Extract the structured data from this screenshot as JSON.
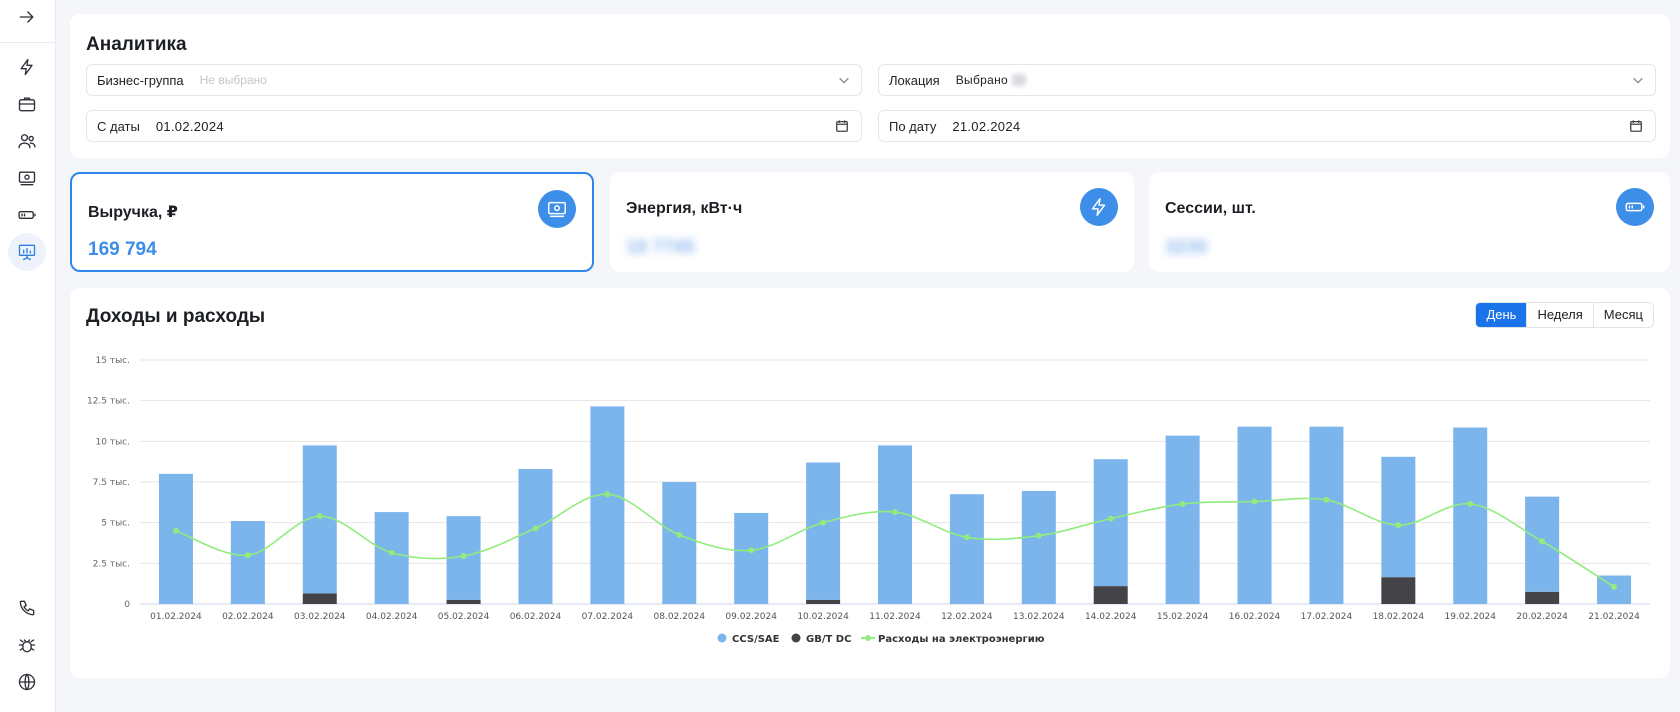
{
  "sidebar": {
    "icons": [
      "arrow-right-icon",
      "lightning-icon",
      "briefcase-icon",
      "users-icon",
      "money-icon",
      "battery-icon",
      "analytics-icon",
      "phone-icon",
      "bug-icon",
      "globe-icon"
    ],
    "active": "analytics-icon"
  },
  "filters": {
    "title": "Аналитика",
    "business_group": {
      "label": "Бизнес-группа",
      "placeholder": "Не выбрано"
    },
    "location": {
      "label": "Локация",
      "value": "Выбрано"
    },
    "date_from": {
      "label": "С даты",
      "value": "01.02.2024"
    },
    "date_to": {
      "label": "По дату",
      "value": "21.02.2024"
    }
  },
  "stats": {
    "revenue": {
      "title": "Выручка, ₽",
      "value": "169 794",
      "icon": "money-icon"
    },
    "energy": {
      "title": "Энергия, кВт·ч",
      "value": "18 7745",
      "icon": "lightning-icon"
    },
    "sessions": {
      "title": "Сессии, шт.",
      "value": "3230",
      "icon": "battery-icon"
    }
  },
  "chart_section": {
    "title": "Доходы и расходы",
    "periods": [
      "День",
      "Неделя",
      "Месяц"
    ],
    "active_period": "День"
  },
  "colors": {
    "accent": "#1a73e8",
    "bar_ccs": "#7cb4ec",
    "bar_gbt": "#434348",
    "line": "#90ed7d"
  },
  "chart_data": {
    "type": "bar",
    "stacked": true,
    "categories": [
      "01.02.2024",
      "02.02.2024",
      "03.02.2024",
      "04.02.2024",
      "05.02.2024",
      "06.02.2024",
      "07.02.2024",
      "08.02.2024",
      "09.02.2024",
      "10.02.2024",
      "11.02.2024",
      "12.02.2024",
      "13.02.2024",
      "14.02.2024",
      "15.02.2024",
      "16.02.2024",
      "17.02.2024",
      "18.02.2024",
      "19.02.2024",
      "20.02.2024",
      "21.02.2024"
    ],
    "series": [
      {
        "name": "CCS/SAE",
        "type": "bar",
        "color": "#7cb4ec",
        "values": [
          8000,
          5100,
          9100,
          5650,
          5150,
          8300,
          12150,
          7500,
          5600,
          8450,
          9750,
          6750,
          6950,
          7800,
          10350,
          10900,
          10900,
          7400,
          10850,
          5850,
          1750
        ]
      },
      {
        "name": "GB/T DC",
        "type": "bar",
        "color": "#434348",
        "values": [
          0,
          0,
          650,
          0,
          250,
          0,
          0,
          0,
          0,
          250,
          0,
          0,
          0,
          1100,
          0,
          0,
          0,
          1650,
          0,
          750,
          0
        ]
      },
      {
        "name": "Расходы на электроэнергию",
        "type": "line",
        "color": "#90ed7d",
        "values": [
          4500,
          3000,
          5400,
          3150,
          2950,
          4650,
          6750,
          4250,
          3300,
          5000,
          5650,
          4100,
          4200,
          5250,
          6150,
          6300,
          6400,
          4850,
          6150,
          3850,
          1050
        ]
      }
    ],
    "y_ticks": [
      "0",
      "2.5 тыс.",
      "5 тыс.",
      "7.5 тыс.",
      "10 тыс.",
      "12.5 тыс.",
      "15 тыс."
    ],
    "ylim": [
      0,
      15000
    ],
    "grid": true,
    "legend": "bottom-center"
  }
}
